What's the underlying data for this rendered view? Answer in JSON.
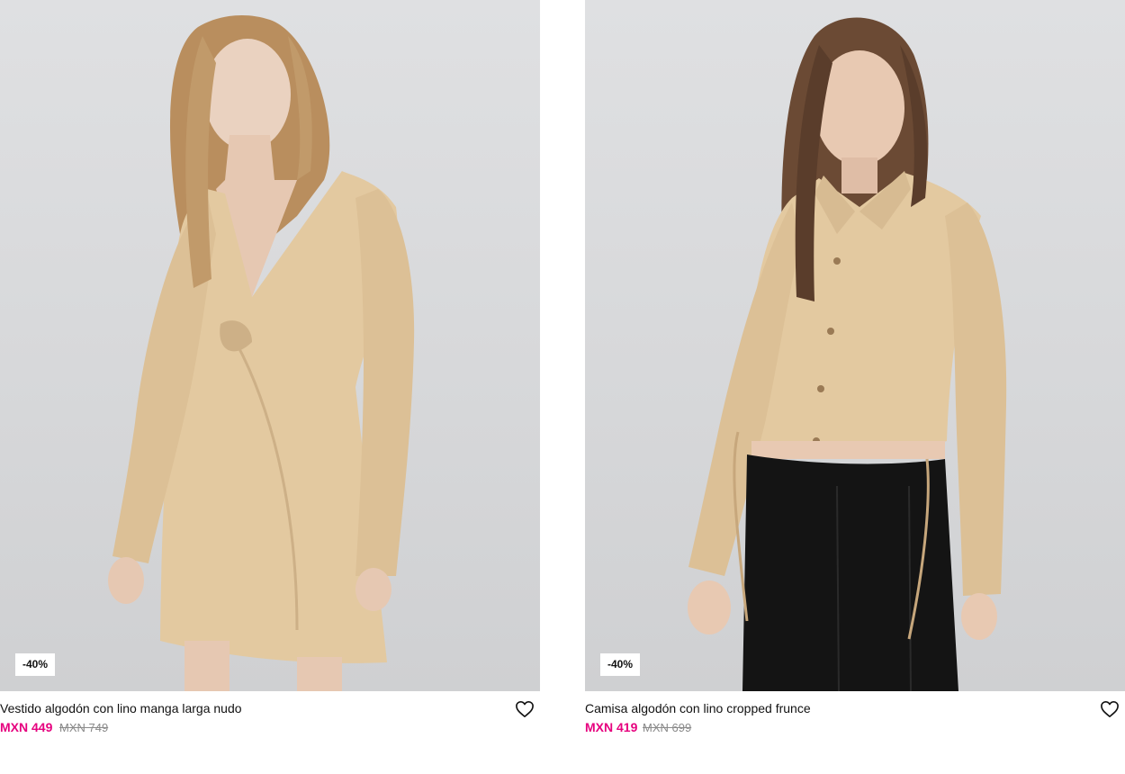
{
  "colors": {
    "sale": "#e6007e",
    "old_price": "#8a8a8a",
    "text": "#111111"
  },
  "products": [
    {
      "name": "Vestido algodón con lino manga larga nudo",
      "price": "MXN 449",
      "old_price": "MXN 749",
      "discount": "-40%",
      "favorite_icon": "heart-icon"
    },
    {
      "name": "Camisa algodón con lino cropped frunce",
      "price": "MXN 419",
      "old_price": "MXN 699",
      "discount": "-40%",
      "favorite_icon": "heart-icon"
    }
  ]
}
